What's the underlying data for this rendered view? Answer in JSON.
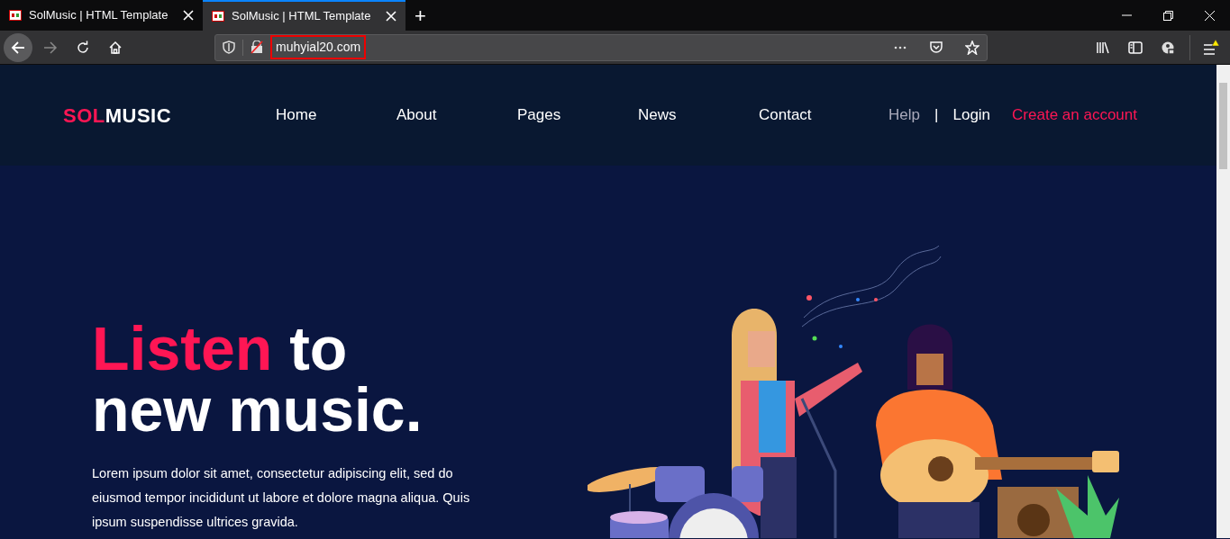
{
  "browser": {
    "tabs": [
      {
        "title": "SolMusic | HTML Template",
        "selected": false
      },
      {
        "title": "SolMusic | HTML Template",
        "selected": true
      }
    ],
    "new_tab": "+",
    "url": "muhyial20.com",
    "url_highlighted": true,
    "menu_warning": true
  },
  "site": {
    "logo": {
      "accent": "SOL",
      "rest": "MUSIC"
    },
    "nav": [
      {
        "label": "Home"
      },
      {
        "label": "About"
      },
      {
        "label": "Pages"
      },
      {
        "label": "News"
      },
      {
        "label": "Contact"
      }
    ],
    "account": [
      {
        "label": "Help",
        "kind": "muted"
      },
      {
        "label": "|",
        "kind": "separator"
      },
      {
        "label": "Login",
        "kind": "plain"
      },
      {
        "label": "Create an account",
        "kind": "accent"
      }
    ],
    "hero": {
      "title_accent": "Listen",
      "title_rest": "to new music.",
      "text": "Lorem ipsum dolor sit amet, consectetur adipiscing elit, sed do eiusmod tempor incididunt ut labore et dolore magna aliqua. Quis ipsum suspendisse ultrices gravida."
    }
  }
}
